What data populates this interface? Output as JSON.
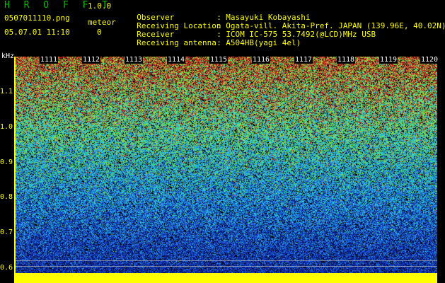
{
  "header": {
    "app_title": "H R O F F T",
    "app_version": "1.0.0",
    "file_name": "0507011110.png",
    "meteor_label": "meteor",
    "meteor_count": "0",
    "date_time": "05.07.01 11:10"
  },
  "info": [
    {
      "label": "Observer",
      "sep": ":",
      "value": "Masayuki Kobayashi"
    },
    {
      "label": "Receiving Location",
      "sep": ":",
      "value": "Ogata-vill. Akita-Pref. JAPAN (139.96E, 40.02N)"
    },
    {
      "label": "Receiver",
      "sep": ":",
      "value": "ICOM IC-575 53.7492(@LCD)MHz USB"
    },
    {
      "label": "Receiving antenna",
      "sep": ":",
      "value": "A504HB(yagi 4el)"
    }
  ],
  "plot": {
    "y_unit": "kHz",
    "y_ticks": [
      "1.1",
      "1.0",
      "0.9",
      "0.8",
      "0.7",
      "0.6"
    ],
    "x_ticks": [
      "1111",
      "1112",
      "1113",
      "1114",
      "1115",
      "1116",
      "1117",
      "1118",
      "1119",
      "1120"
    ],
    "colors": {
      "background": "#000000",
      "text_main": "#ffff00",
      "title_green": "#00c000",
      "noise_floor": "#ffff00",
      "deep_blue": "#0b1c8c",
      "mid_blue": "#1e6ee0",
      "cyan": "#27d6d6",
      "green": "#5ad84a",
      "red": "#d02020"
    }
  }
}
